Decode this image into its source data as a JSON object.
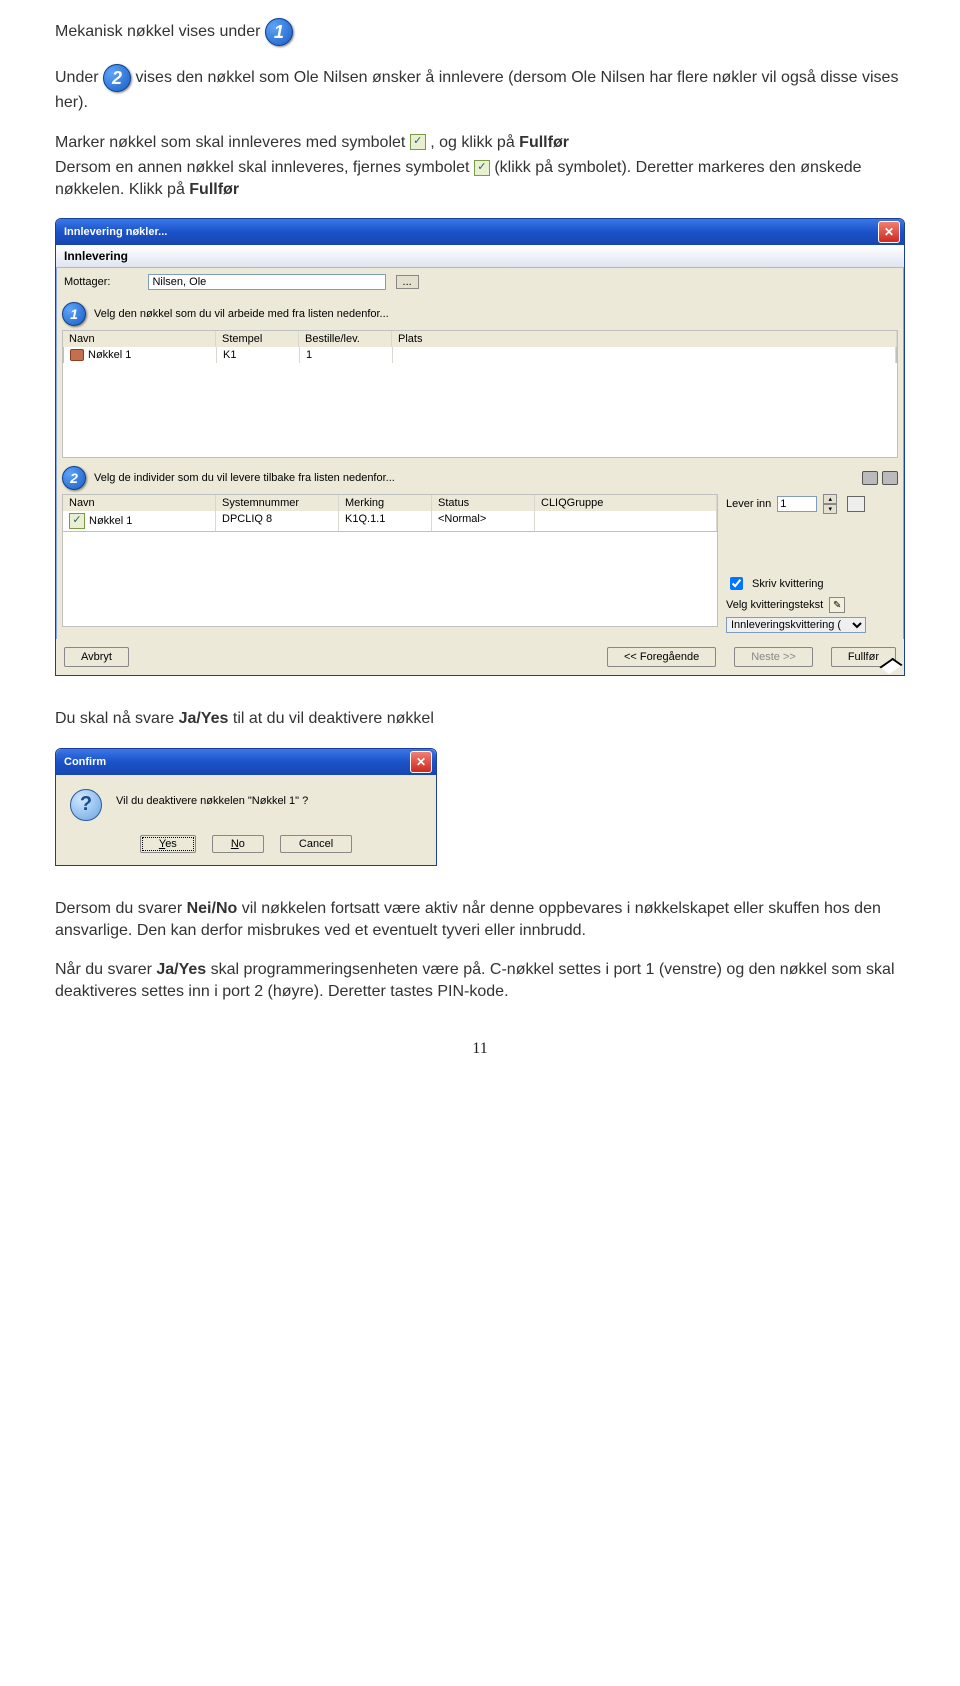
{
  "text": {
    "p1_prefix": "Mekanisk nøkkel vises under ",
    "p2_a": "Under ",
    "p2_b": " vises den nøkkel som Ole Nilsen ønsker å innlevere (dersom Ole Nilsen har flere nøkler vil også disse vises her).",
    "p3_a": "Marker nøkkel som skal innleveres med symbolet ",
    "p3_b": ", og klikk på ",
    "p3_c": "Fullfør",
    "p4_a": "Dersom en annen nøkkel skal innleveres, fjernes symbolet ",
    "p4_b": " (klikk på symbolet). Deretter markeres den ønskede nøkkelen. Klikk på ",
    "p4_c": "Fullfør",
    "p5_a": "Du skal nå svare ",
    "p5_b": "Ja/Yes",
    "p5_c": " til at du vil deaktivere nøkkel",
    "p6_a": "Dersom du svarer ",
    "p6_b": "Nei/No",
    "p6_c": " vil nøkkelen fortsatt være aktiv når denne oppbevares i nøkkelskapet eller skuffen hos den ansvarlige. Den kan derfor misbrukes ved et eventuelt tyveri eller innbrudd.",
    "p7_a": "Når du svarer ",
    "p7_b": "Ja/Yes",
    "p7_c": " skal programmeringsenheten være på. C-nøkkel settes i port 1 (venstre) og den nøkkel som skal deaktiveres settes inn i port 2 (høyre). Deretter tastes PIN-kode.",
    "page_number": "11"
  },
  "win1": {
    "title": "Innlevering nøkler...",
    "subtitle": "Innlevering",
    "mottager_label": "Mottager:",
    "mottager_value": "Nilsen, Ole",
    "ellipsis": "...",
    "sec1_title": "Velg den nøkkel som du vil arbeide med fra listen nedenfor...",
    "sec1_headers": {
      "navn": "Navn",
      "stempel": "Stempel",
      "bestille": "Bestille/lev.",
      "plats": "Plats"
    },
    "sec1_row": {
      "navn": "Nøkkel 1",
      "stempel": "K1",
      "bestille": "1",
      "plats": ""
    },
    "sec2_title": "Velg de individer som du vil levere tilbake fra listen nedenfor...",
    "sec2_headers": {
      "navn": "Navn",
      "sysnum": "Systemnummer",
      "merking": "Merking",
      "status": "Status",
      "cliq": "CLIQGruppe"
    },
    "sec2_row": {
      "navn": "Nøkkel 1",
      "sysnum": "DPCLIQ 8",
      "merking": "K1Q.1.1",
      "status": "<Normal>",
      "cliq": ""
    },
    "lever_label": "Lever inn",
    "lever_value": "1",
    "skriv_kvitt": "Skriv kvittering",
    "velg_kvitt": "Velg kvitteringstekst",
    "kvitt_val": "Innleveringskvittering (",
    "btn_avbryt": "Avbryt",
    "btn_prev": "<< Foregående",
    "btn_next": "Neste   >>",
    "btn_fullfor": "Fullfør"
  },
  "confirm": {
    "title": "Confirm",
    "message": "Vil du deaktivere nøkkelen \"Nøkkel 1\" ?",
    "yes_u": "Y",
    "yes_rest": "es",
    "no_u": "N",
    "no_rest": "o",
    "cancel": "Cancel"
  }
}
